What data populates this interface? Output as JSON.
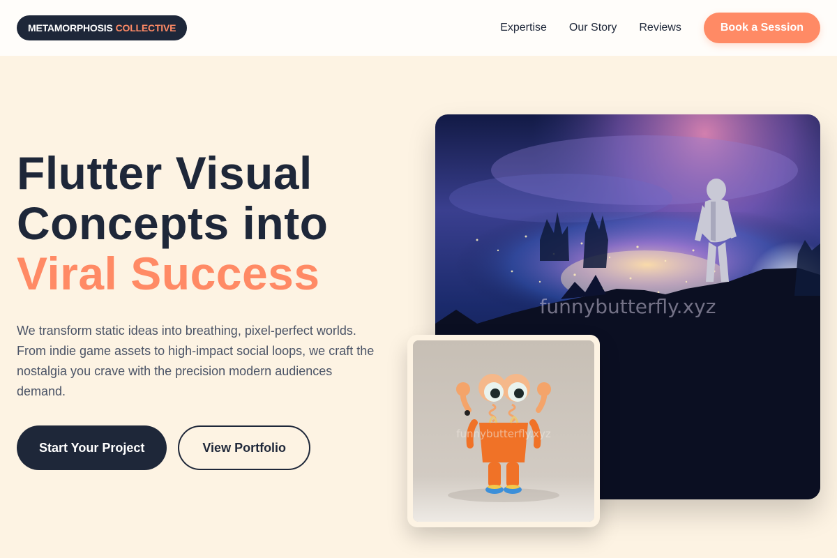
{
  "nav": {
    "logo_main": "METAMORPHOSIS",
    "logo_accent": "COLLECTIVE",
    "links": [
      "Expertise",
      "Our Story",
      "Reviews"
    ],
    "cta": "Book a Session"
  },
  "hero": {
    "headline_line1": "Flutter Visual",
    "headline_line2": "Concepts into",
    "headline_line3": "Viral Success",
    "subtitle": "We transform static ideas into breathing, pixel-perfect worlds. From indie game assets to high-impact social loops, we craft the nostalgia you crave with the precision modern audiences demand.",
    "primary_button": "Start Your Project",
    "secondary_button": "View Portfolio"
  },
  "images": {
    "main_watermark": "funnybutterfly.xyz",
    "card_watermark": "funnybutterfly.xyz"
  },
  "colors": {
    "accent": "#ff8a65",
    "dark": "#1e2739",
    "background": "#fdf3e3"
  }
}
